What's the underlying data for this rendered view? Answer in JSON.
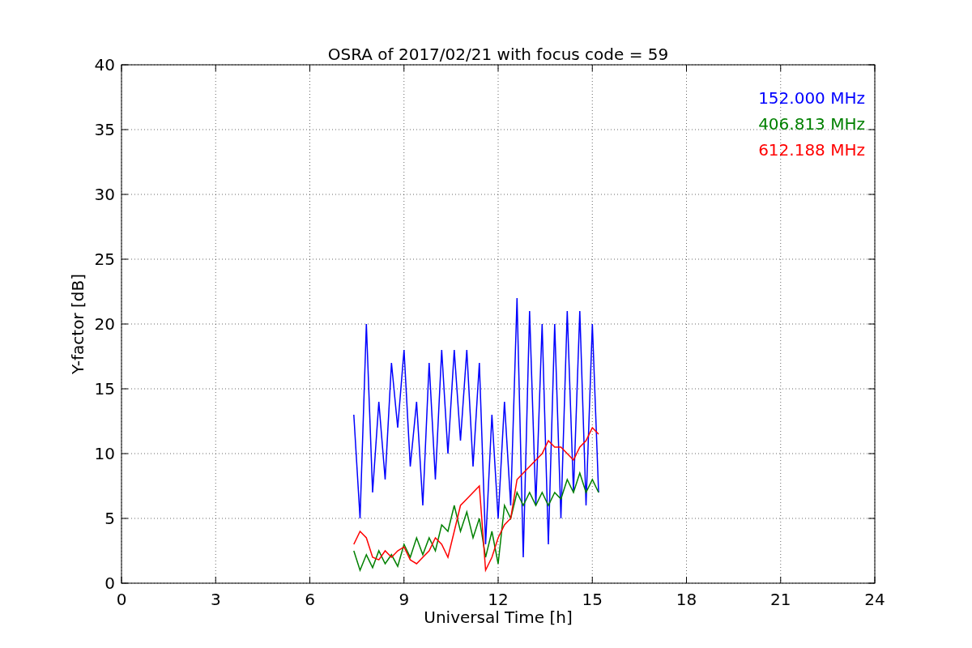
{
  "chart_data": {
    "type": "line",
    "title": "OSRA of 2017/02/21 with focus code = 59",
    "xlabel": "Universal Time [h]",
    "ylabel": "Y-factor [dB]",
    "grid": true,
    "xlim": [
      0,
      24
    ],
    "ylim": [
      0,
      40
    ],
    "xticks": [
      0,
      3,
      6,
      9,
      12,
      15,
      18,
      21,
      24
    ],
    "yticks": [
      0,
      5,
      10,
      15,
      20,
      25,
      30,
      35,
      40
    ],
    "x": [
      7.4,
      7.6,
      7.8,
      8.0,
      8.2,
      8.4,
      8.6,
      8.8,
      9.0,
      9.2,
      9.4,
      9.6,
      9.8,
      10.0,
      10.2,
      10.4,
      10.6,
      10.8,
      11.0,
      11.2,
      11.4,
      11.6,
      11.8,
      12.0,
      12.2,
      12.4,
      12.6,
      12.8,
      13.0,
      13.2,
      13.4,
      13.6,
      13.8,
      14.0,
      14.2,
      14.4,
      14.6,
      14.8,
      15.0,
      15.2
    ],
    "series": [
      {
        "name": "152.000 MHz",
        "color": "#0000ff",
        "values": [
          13,
          5,
          20,
          7,
          14,
          8,
          17,
          12,
          18,
          9,
          14,
          6,
          17,
          8,
          18,
          10,
          18,
          11,
          18,
          9,
          17,
          3,
          13,
          5,
          14,
          6,
          22,
          2,
          21,
          6,
          20,
          3,
          20,
          5,
          21,
          7,
          21,
          6,
          20,
          7
        ]
      },
      {
        "name": "406.813 MHz",
        "color": "#008000",
        "values": [
          2.5,
          1,
          2.2,
          1.2,
          2.5,
          1.5,
          2.2,
          1.3,
          3,
          2,
          3.5,
          2.2,
          3.5,
          2.5,
          4.5,
          4,
          6,
          4,
          5.5,
          3.5,
          5,
          2,
          4,
          1.5,
          6,
          5,
          7,
          6,
          7,
          6,
          7,
          6,
          7,
          6.5,
          8,
          7,
          8.5,
          7,
          8,
          7
        ]
      },
      {
        "name": "612.188 MHz",
        "color": "#ff0000",
        "values": [
          3,
          4,
          3.5,
          2,
          1.8,
          2.5,
          2,
          2.5,
          2.8,
          1.8,
          1.5,
          2,
          2.5,
          3.5,
          3,
          2,
          4,
          6,
          6.5,
          7,
          7.5,
          1,
          2,
          3.5,
          4.5,
          5,
          8,
          8.5,
          9,
          9.5,
          10,
          11,
          10.5,
          10.5,
          10,
          9.5,
          10.5,
          11,
          12,
          11.5
        ]
      }
    ]
  }
}
